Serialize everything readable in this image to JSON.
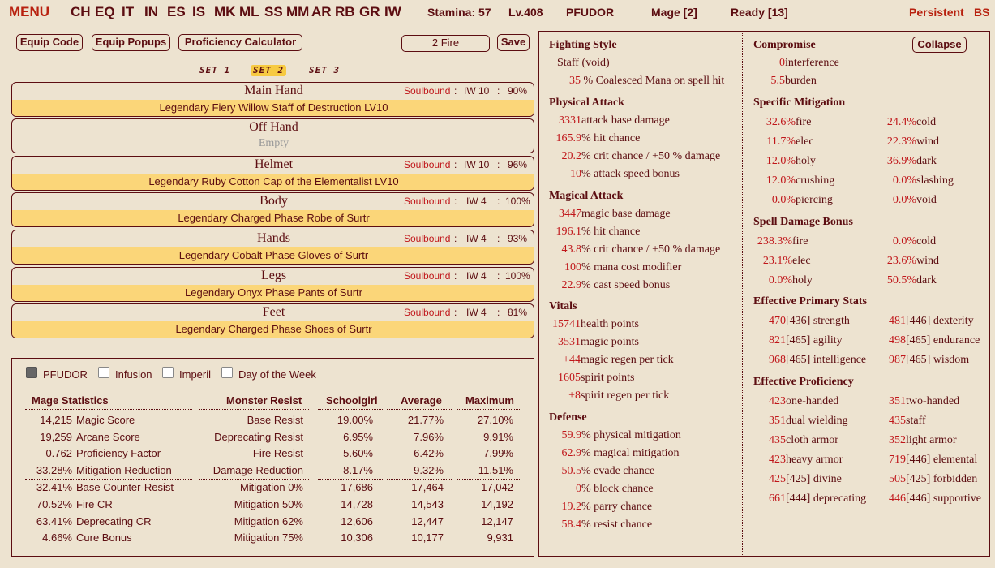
{
  "topbar": {
    "menu": "MENU",
    "nav": [
      "CH",
      "EQ",
      "IT",
      "IN",
      "ES",
      "IS",
      "MK",
      "ML",
      "SS",
      "MM",
      "AR",
      "RB",
      "GR",
      "IW"
    ],
    "stamina": "Stamina: 57",
    "level": "Lv.408",
    "name": "PFUDOR",
    "class": "Mage [2]",
    "ready": "Ready [13]",
    "persistent": "Persistent",
    "bs": "BS"
  },
  "toolbar": {
    "equip_code": "Equip Code",
    "equip_popups": "Equip Popups",
    "proficiency_calc": "Proficiency Calculator",
    "fire_field": "2 Fire",
    "save": "Save"
  },
  "sets": [
    "SET 1",
    "SET 2",
    "SET 3"
  ],
  "slots": [
    {
      "name": "Main Hand",
      "soulbound": "Soulbound",
      "iw": "IW 10",
      "pct": "90%",
      "item": "Legendary Fiery Willow Staff of Destruction LV10"
    },
    {
      "name": "Off Hand",
      "empty": "Empty"
    },
    {
      "name": "Helmet",
      "soulbound": "Soulbound",
      "iw": "IW 10",
      "pct": "96%",
      "item": "Legendary Ruby Cotton Cap of the Elementalist LV10"
    },
    {
      "name": "Body",
      "soulbound": "Soulbound",
      "iw": "IW 4",
      "pct": "100%",
      "item": "Legendary Charged Phase Robe of Surtr"
    },
    {
      "name": "Hands",
      "soulbound": "Soulbound",
      "iw": "IW 4",
      "pct": "93%",
      "item": "Legendary Cobalt Phase Gloves of Surtr"
    },
    {
      "name": "Legs",
      "soulbound": "Soulbound",
      "iw": "IW 4",
      "pct": "100%",
      "item": "Legendary Onyx Phase Pants of Surtr"
    },
    {
      "name": "Feet",
      "soulbound": "Soulbound",
      "iw": "IW 4",
      "pct": "81%",
      "item": "Legendary Charged Phase Shoes of Surtr"
    }
  ],
  "checkboxes": [
    {
      "label": "PFUDOR",
      "checked": true
    },
    {
      "label": "Infusion",
      "checked": false
    },
    {
      "label": "Imperil",
      "checked": false
    },
    {
      "label": "Day of the Week",
      "checked": false
    }
  ],
  "mage_stats": {
    "header": "Mage Statistics",
    "rows": [
      {
        "v": "14,215",
        "k": "Magic Score"
      },
      {
        "v": "19,259",
        "k": "Arcane Score"
      },
      {
        "v": "0.762",
        "k": "Proficiency Factor"
      },
      {
        "v": "33.28%",
        "k": "Mitigation Reduction"
      },
      {
        "v": "32.41%",
        "k": "Base Counter-Resist"
      },
      {
        "v": "70.52%",
        "k": "Fire CR"
      },
      {
        "v": "63.41%",
        "k": "Deprecating CR"
      },
      {
        "v": "4.66%",
        "k": "Cure Bonus"
      }
    ]
  },
  "resist_table": {
    "headers": [
      "Monster Resist",
      "Schoolgirl",
      "Average",
      "Maximum"
    ],
    "rows": [
      [
        "Base Resist",
        "19.00%",
        "21.77%",
        "27.10%"
      ],
      [
        "Deprecating Resist",
        "6.95%",
        "7.96%",
        "9.91%"
      ],
      [
        "Fire Resist",
        "5.60%",
        "6.42%",
        "7.99%"
      ],
      [
        "Damage Reduction",
        "8.17%",
        "9.32%",
        "11.51%"
      ],
      [
        "Mitigation 0%",
        "17,686",
        "17,464",
        "17,042"
      ],
      [
        "Mitigation 50%",
        "14,728",
        "14,543",
        "14,192"
      ],
      [
        "Mitigation 62%",
        "12,606",
        "12,447",
        "12,147"
      ],
      [
        "Mitigation 75%",
        "10,306",
        "10,177",
        "9,931"
      ]
    ]
  },
  "mid": {
    "fighting_style": {
      "title": "Fighting Style",
      "line1": "Staff (void)",
      "v2": "35",
      "t2": " % Coalesced Mana on spell hit"
    },
    "physical": {
      "title": "Physical Attack",
      "rows": [
        {
          "v": "3331",
          "t": " attack base damage"
        },
        {
          "v": "165.9",
          "t": " % hit chance"
        },
        {
          "v": "20.2",
          "t": " % crit chance / +50 % damage"
        },
        {
          "v": "10",
          "t": " % attack speed bonus"
        }
      ]
    },
    "magical": {
      "title": "Magical Attack",
      "rows": [
        {
          "v": "3447",
          "t": " magic base damage"
        },
        {
          "v": "196.1",
          "t": " % hit chance"
        },
        {
          "v": "43.8",
          "t": " % crit chance / +50 % damage"
        },
        {
          "v": "100",
          "t": " % mana cost modifier"
        },
        {
          "v": "22.9",
          "t": " % cast speed bonus"
        }
      ]
    },
    "vitals": {
      "title": "Vitals",
      "rows": [
        {
          "v": "15741",
          "t": " health points"
        },
        {
          "v": "3531",
          "t": " magic points"
        },
        {
          "v": "+44",
          "t": " magic regen per tick"
        },
        {
          "v": "1605",
          "t": " spirit points"
        },
        {
          "v": "+8",
          "t": " spirit regen per tick"
        }
      ]
    },
    "defense": {
      "title": "Defense",
      "rows": [
        {
          "v": "59.9",
          "t": " % physical mitigation"
        },
        {
          "v": "62.9",
          "t": " % magical mitigation"
        },
        {
          "v": "50.5",
          "t": " % evade chance"
        },
        {
          "v": "0",
          "t": " % block chance"
        },
        {
          "v": "19.2",
          "t": " % parry chance"
        },
        {
          "v": "58.4",
          "t": " % resist chance"
        }
      ]
    }
  },
  "right": {
    "compromise": {
      "title": "Compromise",
      "collapse": "Collapse",
      "rows": [
        {
          "v": "0",
          "t": " interference"
        },
        {
          "v": "5.5",
          "t": " burden"
        }
      ]
    },
    "specific_mitigation": {
      "title": "Specific Mitigation",
      "rows": [
        [
          {
            "v": "32.6%",
            "t": " fire"
          },
          {
            "v": "24.4%",
            "t": " cold"
          }
        ],
        [
          {
            "v": "11.7%",
            "t": " elec"
          },
          {
            "v": "22.3%",
            "t": " wind"
          }
        ],
        [
          {
            "v": "12.0%",
            "t": " holy"
          },
          {
            "v": "36.9%",
            "t": " dark"
          }
        ],
        [
          {
            "v": "12.0%",
            "t": " crushing"
          },
          {
            "v": "0.0%",
            "t": " slashing"
          }
        ],
        [
          {
            "v": "0.0%",
            "t": " piercing"
          },
          {
            "v": "0.0%",
            "t": " void"
          }
        ]
      ]
    },
    "spell_damage": {
      "title": "Spell Damage Bonus",
      "rows": [
        [
          {
            "v": "238.3%",
            "t": " fire"
          },
          {
            "v": "0.0%",
            "t": " cold"
          }
        ],
        [
          {
            "v": "23.1%",
            "t": " elec"
          },
          {
            "v": "23.6%",
            "t": " wind"
          }
        ],
        [
          {
            "v": "0.0%",
            "t": " holy"
          },
          {
            "v": "50.5%",
            "t": " dark"
          }
        ]
      ]
    },
    "primary": {
      "title": "Effective Primary Stats",
      "rows": [
        [
          {
            "v": "470",
            "t": " [436] strength"
          },
          {
            "v": "481",
            "t": " [446] dexterity"
          }
        ],
        [
          {
            "v": "821",
            "t": " [465] agility"
          },
          {
            "v": "498",
            "t": " [465] endurance"
          }
        ],
        [
          {
            "v": "968",
            "t": " [465] intelligence"
          },
          {
            "v": "987",
            "t": " [465] wisdom"
          }
        ]
      ]
    },
    "proficiency": {
      "title": "Effective Proficiency",
      "rows": [
        [
          {
            "v": "423",
            "t": " one-handed"
          },
          {
            "v": "351",
            "t": " two-handed"
          }
        ],
        [
          {
            "v": "351",
            "t": " dual wielding"
          },
          {
            "v": "435",
            "t": " staff"
          }
        ],
        [
          {
            "v": "435",
            "t": " cloth armor"
          },
          {
            "v": "352",
            "t": " light armor"
          }
        ],
        [
          {
            "v": "423",
            "t": " heavy armor"
          },
          {
            "v": "719",
            "t": " [446] elemental"
          }
        ],
        [
          {
            "v": "425",
            "t": " [425] divine"
          },
          {
            "v": "505",
            "t": " [425] forbidden"
          }
        ],
        [
          {
            "v": "661",
            "t": " [444] deprecating"
          },
          {
            "v": "446",
            "t": " [446] supportive"
          }
        ]
      ]
    }
  }
}
